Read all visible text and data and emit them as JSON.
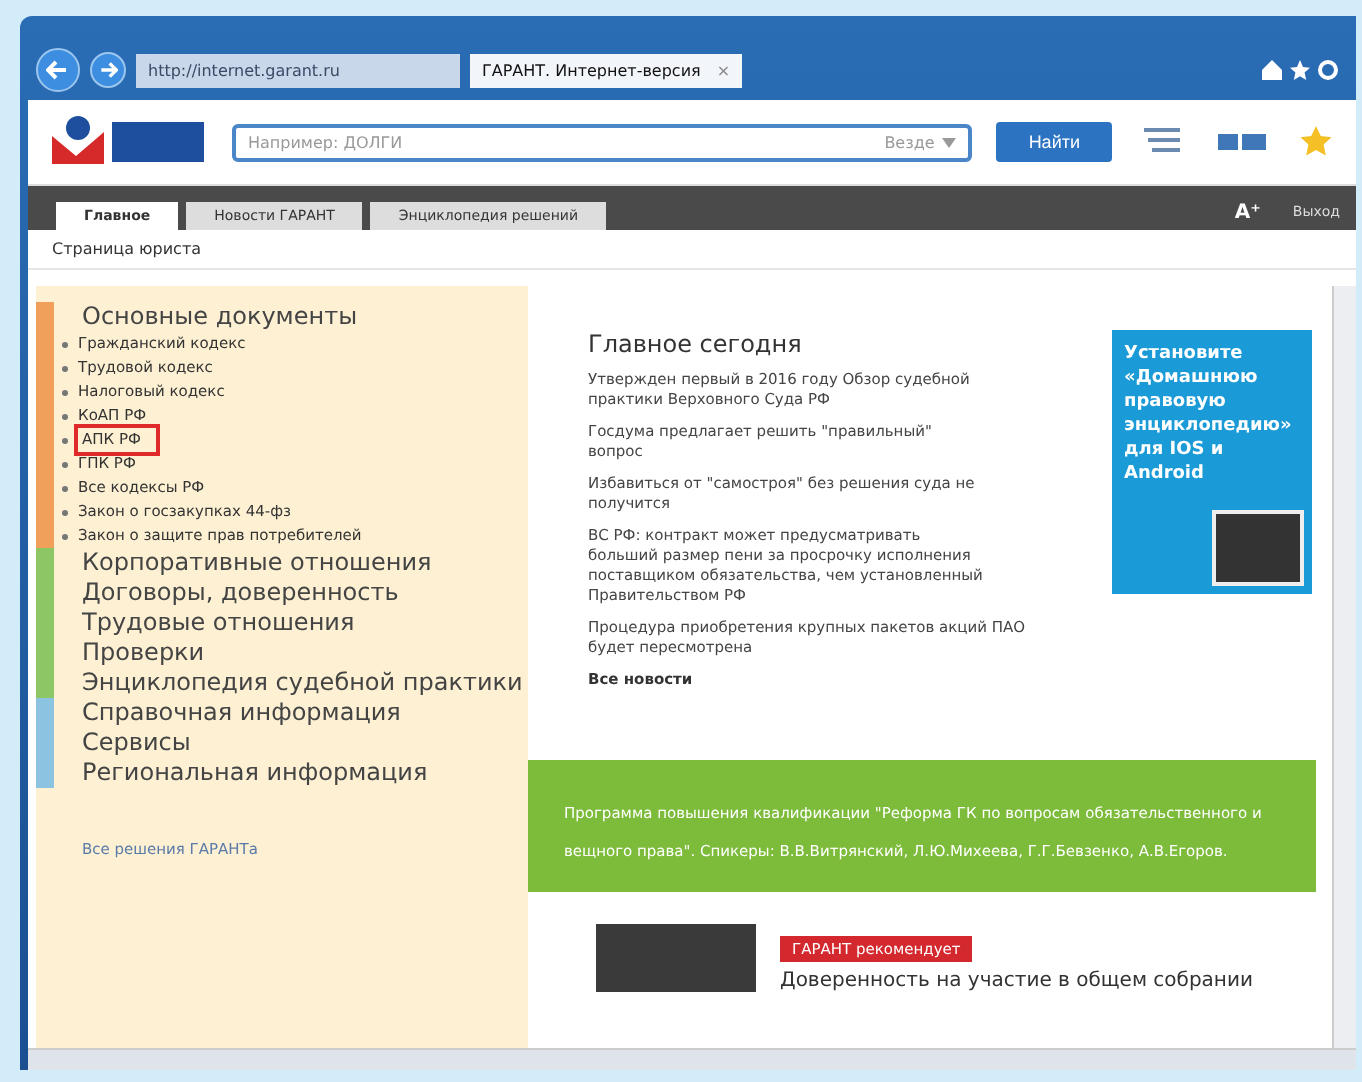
{
  "browser": {
    "address": "http://internet.garant.ru",
    "tabs": [
      {
        "label": "ГАРАНТ. Интернет-версия",
        "selected": true,
        "close": "×"
      }
    ]
  },
  "header": {
    "search": {
      "placeholder": "Например: ДОЛГИ",
      "scope": "Везде",
      "button": "Найти"
    }
  },
  "nav": {
    "tabs": [
      {
        "label": "Главное",
        "selected": true
      },
      {
        "label": "Новости ГАРАНТ",
        "selected": false
      },
      {
        "label": "Энциклопедия решений",
        "selected": false
      }
    ],
    "font_size": "A⁺",
    "logout": "Выход"
  },
  "breadcrumb": "Страница юриста",
  "sidebar": {
    "sections": [
      {
        "title": "Основные документы",
        "color": "#f0a05a",
        "children": [
          {
            "label": "Гражданский кодекс",
            "highlighted": false
          },
          {
            "label": "Трудовой кодекс",
            "highlighted": false
          },
          {
            "label": "Налоговый кодекс",
            "highlighted": false
          },
          {
            "label": "КоАП РФ",
            "highlighted": false
          },
          {
            "label": "АПК РФ",
            "highlighted": true
          },
          {
            "label": "ГПК РФ",
            "highlighted": false
          },
          {
            "label": "Все кодексы РФ",
            "highlighted": false
          },
          {
            "label": "Закон о госзакупках 44-фз",
            "highlighted": false
          },
          {
            "label": "Закон о защите прав потребителей",
            "highlighted": false
          }
        ]
      },
      {
        "title": "Корпоративные отношения",
        "color": "#8cc665"
      },
      {
        "title": "Договоры, доверенность",
        "color": "#8cc665"
      },
      {
        "title": "Трудовые отношения",
        "color": "#8cc665"
      },
      {
        "title": "Проверки",
        "color": "#8cc665"
      },
      {
        "title": "Энциклопедия судебной практики",
        "color": "#8cc665"
      },
      {
        "title": "Справочная информация",
        "color": "#8cc3e0"
      },
      {
        "title": "Сервисы",
        "color": "#8cc3e0"
      },
      {
        "title": "Региональная информация",
        "color": "#8cc3e0"
      }
    ],
    "footer_link": "Все решения ГАРАНТа"
  },
  "main": {
    "heading": "Главное сегодня",
    "news": [
      "Утвержден первый в 2016 году Обзор судебной практики Верховного Суда РФ",
      "Госдума предлагает решить \"правильный\" вопрос",
      "Избавиться от \"самостроя\" без решения суда не получится",
      "ВС РФ: контракт может предусматривать больший размер пени за просрочку исполнения поставщиком обязательства, чем установленный Правительством РФ",
      "Процедура приобретения крупных пакетов акций ПАО будет пересмотрена"
    ],
    "all_news": "Все новости",
    "promo": "Установите «Домашнюю правовую энциклопедию» для IOS и Android",
    "banner": "Программа повышения квалификации \"Реформа ГК по вопросам обязательственного и вещного права\". Спикеры: В.В.Витрянский, Л.Ю.Михеева, Г.Г.Бевзенко, А.В.Егоров.",
    "recommend": {
      "badge": "ГАРАНТ рекомендует",
      "title": "Доверенность на участие в общем собрании"
    }
  }
}
